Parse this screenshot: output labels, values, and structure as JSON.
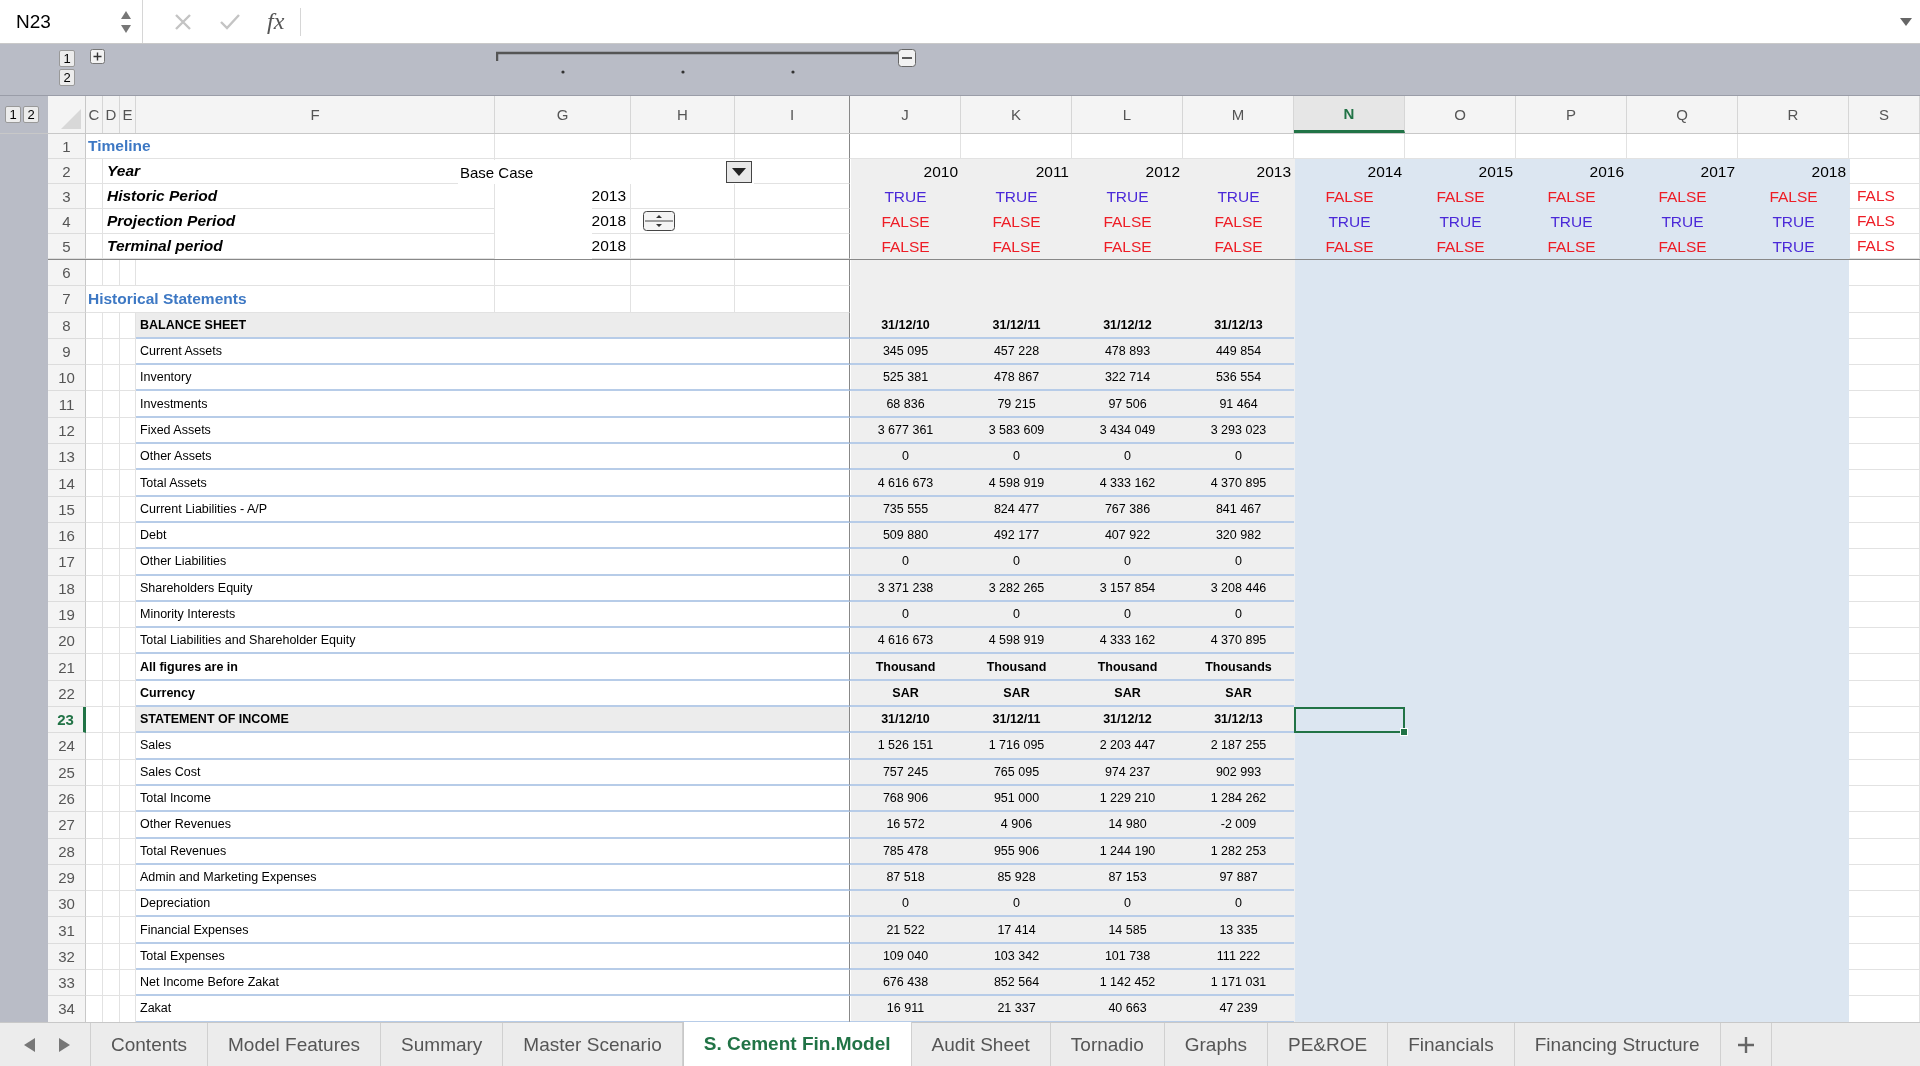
{
  "formula_bar": {
    "cell_ref": "N23",
    "function_label": "fx"
  },
  "outline": {
    "column_levels": [
      "1",
      "2"
    ],
    "row_levels": [
      "1",
      "2"
    ]
  },
  "columns": [
    {
      "label": "C",
      "selected": false
    },
    {
      "label": "D",
      "selected": false
    },
    {
      "label": "E",
      "selected": false
    },
    {
      "label": "F",
      "selected": false
    },
    {
      "label": "G",
      "selected": false
    },
    {
      "label": "H",
      "selected": false
    },
    {
      "label": "I",
      "selected": false
    },
    {
      "label": "J",
      "selected": false
    },
    {
      "label": "K",
      "selected": false
    },
    {
      "label": "L",
      "selected": false
    },
    {
      "label": "M",
      "selected": false
    },
    {
      "label": "N",
      "selected": true
    },
    {
      "label": "O",
      "selected": false
    },
    {
      "label": "P",
      "selected": false
    },
    {
      "label": "Q",
      "selected": false
    },
    {
      "label": "R",
      "selected": false
    },
    {
      "label": "S",
      "selected": false
    }
  ],
  "sheet": {
    "frozen_rows": [
      {
        "number": "1",
        "selected": false,
        "kind": "section",
        "label": "Timeline"
      },
      {
        "number": "2",
        "selected": false,
        "kind": "param",
        "label": "Year",
        "control": {
          "kind": "dropdown",
          "value": "Base Case"
        },
        "cells": [
          "2010",
          "2011",
          "2012",
          "2013",
          "2014",
          "2015",
          "2016",
          "2017",
          "2018"
        ]
      },
      {
        "number": "3",
        "selected": false,
        "kind": "param",
        "label": "Historic Period",
        "value": "2013",
        "cells": [
          {
            "text": "TRUE",
            "on": true
          },
          {
            "text": "TRUE",
            "on": true
          },
          {
            "text": "TRUE",
            "on": true
          },
          {
            "text": "TRUE",
            "on": true
          },
          {
            "text": "FALSE",
            "on": false
          },
          {
            "text": "FALSE",
            "on": false
          },
          {
            "text": "FALSE",
            "on": false
          },
          {
            "text": "FALSE",
            "on": false
          },
          {
            "text": "FALSE",
            "on": false
          }
        ],
        "overflow": {
          "text": "FALS",
          "on": false
        }
      },
      {
        "number": "4",
        "selected": false,
        "kind": "param",
        "label": "Projection Period",
        "value": "2018",
        "control": {
          "kind": "spinner"
        },
        "cells": [
          {
            "text": "FALSE",
            "on": false
          },
          {
            "text": "FALSE",
            "on": false
          },
          {
            "text": "FALSE",
            "on": false
          },
          {
            "text": "FALSE",
            "on": false
          },
          {
            "text": "TRUE",
            "on": true
          },
          {
            "text": "TRUE",
            "on": true
          },
          {
            "text": "TRUE",
            "on": true
          },
          {
            "text": "TRUE",
            "on": true
          },
          {
            "text": "TRUE",
            "on": true
          }
        ],
        "overflow": {
          "text": "FALS",
          "on": false
        }
      },
      {
        "number": "5",
        "selected": false,
        "kind": "param",
        "label": "Terminal period",
        "value": "2018",
        "cells": [
          {
            "text": "FALSE",
            "on": false
          },
          {
            "text": "FALSE",
            "on": false
          },
          {
            "text": "FALSE",
            "on": false
          },
          {
            "text": "FALSE",
            "on": false
          },
          {
            "text": "FALSE",
            "on": false
          },
          {
            "text": "FALSE",
            "on": false
          },
          {
            "text": "FALSE",
            "on": false
          },
          {
            "text": "FALSE",
            "on": false
          },
          {
            "text": "TRUE",
            "on": true
          }
        ],
        "overflow": {
          "text": "FALS",
          "on": false
        }
      }
    ],
    "rows": [
      {
        "number": "6",
        "selected": false,
        "kind": "blank"
      },
      {
        "number": "7",
        "selected": false,
        "kind": "section",
        "label": "Historical Statements"
      },
      {
        "number": "8",
        "selected": false,
        "kind": "heading",
        "label": "BALANCE SHEET",
        "cells": [
          "31/12/10",
          "31/12/11",
          "31/12/12",
          "31/12/13"
        ]
      },
      {
        "number": "9",
        "selected": false,
        "kind": "data",
        "label": "Current Assets",
        "cells": [
          "345 095",
          "457 228",
          "478 893",
          "449 854"
        ]
      },
      {
        "number": "10",
        "selected": false,
        "kind": "data",
        "label": "Inventory",
        "cells": [
          "525 381",
          "478 867",
          "322 714",
          "536 554"
        ]
      },
      {
        "number": "11",
        "selected": false,
        "kind": "data",
        "label": "Investments",
        "cells": [
          "68 836",
          "79 215",
          "97 506",
          "91 464"
        ]
      },
      {
        "number": "12",
        "selected": false,
        "kind": "data",
        "label": "Fixed Assets",
        "cells": [
          "3 677 361",
          "3 583 609",
          "3 434 049",
          "3 293 023"
        ]
      },
      {
        "number": "13",
        "selected": false,
        "kind": "data",
        "label": "Other Assets",
        "cells": [
          "0",
          "0",
          "0",
          "0"
        ]
      },
      {
        "number": "14",
        "selected": false,
        "kind": "data",
        "label": "Total Assets",
        "cells": [
          "4 616 673",
          "4 598 919",
          "4 333 162",
          "4 370 895"
        ]
      },
      {
        "number": "15",
        "selected": false,
        "kind": "data",
        "label": "Current Liabilities - A/P",
        "cells": [
          "735 555",
          "824 477",
          "767 386",
          "841 467"
        ]
      },
      {
        "number": "16",
        "selected": false,
        "kind": "data",
        "label": "Debt",
        "cells": [
          "509 880",
          "492 177",
          "407 922",
          "320 982"
        ]
      },
      {
        "number": "17",
        "selected": false,
        "kind": "data",
        "label": "Other Liabilities",
        "cells": [
          "0",
          "0",
          "0",
          "0"
        ]
      },
      {
        "number": "18",
        "selected": false,
        "kind": "data",
        "label": "Shareholders Equity",
        "cells": [
          "3 371 238",
          "3 282 265",
          "3 157 854",
          "3 208 446"
        ]
      },
      {
        "number": "19",
        "selected": false,
        "kind": "data",
        "label": "Minority Interests",
        "cells": [
          "0",
          "0",
          "0",
          "0"
        ]
      },
      {
        "number": "20",
        "selected": false,
        "kind": "data",
        "label": "Total Liabilities and Shareholder Equity",
        "cells": [
          "4 616 673",
          "4 598 919",
          "4 333 162",
          "4 370 895"
        ]
      },
      {
        "number": "21",
        "selected": false,
        "kind": "units",
        "label": "All figures are in",
        "cells": [
          "Thousand",
          "Thousand",
          "Thousand",
          "Thousands"
        ]
      },
      {
        "number": "22",
        "selected": false,
        "kind": "units",
        "label": "Currency",
        "cells": [
          "SAR",
          "SAR",
          "SAR",
          "SAR"
        ]
      },
      {
        "number": "23",
        "selected": true,
        "kind": "heading",
        "label": "STATEMENT OF INCOME",
        "cells": [
          "31/12/10",
          "31/12/11",
          "31/12/12",
          "31/12/13"
        ]
      },
      {
        "number": "24",
        "selected": false,
        "kind": "data",
        "label": "Sales",
        "cells": [
          "1 526 151",
          "1 716 095",
          "2 203 447",
          "2 187 255"
        ]
      },
      {
        "number": "25",
        "selected": false,
        "kind": "data",
        "label": "Sales Cost",
        "cells": [
          "757 245",
          "765 095",
          "974 237",
          "902 993"
        ]
      },
      {
        "number": "26",
        "selected": false,
        "kind": "data",
        "label": "Total Income",
        "cells": [
          "768 906",
          "951 000",
          "1 229 210",
          "1 284 262"
        ]
      },
      {
        "number": "27",
        "selected": false,
        "kind": "data",
        "label": "Other Revenues",
        "cells": [
          "16 572",
          "4 906",
          "14 980",
          "-2 009"
        ]
      },
      {
        "number": "28",
        "selected": false,
        "kind": "data",
        "label": "Total Revenues",
        "cells": [
          "785 478",
          "955 906",
          "1 244 190",
          "1 282 253"
        ]
      },
      {
        "number": "29",
        "selected": false,
        "kind": "data",
        "label": "Admin and Marketing Expenses",
        "cells": [
          "87 518",
          "85 928",
          "87 153",
          "97 887"
        ]
      },
      {
        "number": "30",
        "selected": false,
        "kind": "data",
        "label": "Depreciation",
        "cells": [
          "0",
          "0",
          "0",
          "0"
        ]
      },
      {
        "number": "31",
        "selected": false,
        "kind": "data",
        "label": "Financial Expenses",
        "cells": [
          "21 522",
          "17 414",
          "14 585",
          "13 335"
        ]
      },
      {
        "number": "32",
        "selected": false,
        "kind": "data",
        "label": "Total Expenses",
        "cells": [
          "109 040",
          "103 342",
          "101 738",
          "111 222"
        ]
      },
      {
        "number": "33",
        "selected": false,
        "kind": "data",
        "label": "Net Income Before Zakat",
        "cells": [
          "676 438",
          "852 564",
          "1 142 452",
          "1 171 031"
        ]
      },
      {
        "number": "34",
        "selected": false,
        "kind": "data",
        "label": "Zakat",
        "cells": [
          "16 911",
          "21 337",
          "40 663",
          "47 239"
        ]
      }
    ]
  },
  "tabs": [
    {
      "label": "Contents",
      "selected": false
    },
    {
      "label": "Model Features",
      "selected": false
    },
    {
      "label": "Summary",
      "selected": false
    },
    {
      "label": "Master Scenario",
      "selected": false
    },
    {
      "label": "S. Cement Fin.Model",
      "selected": true
    },
    {
      "label": "Audit Sheet",
      "selected": false
    },
    {
      "label": "Tornadio",
      "selected": false
    },
    {
      "label": "Graphs",
      "selected": false
    },
    {
      "label": "PE&ROE",
      "selected": false
    },
    {
      "label": "Financials",
      "selected": false
    },
    {
      "label": "Financing Structure",
      "selected": false
    }
  ]
}
